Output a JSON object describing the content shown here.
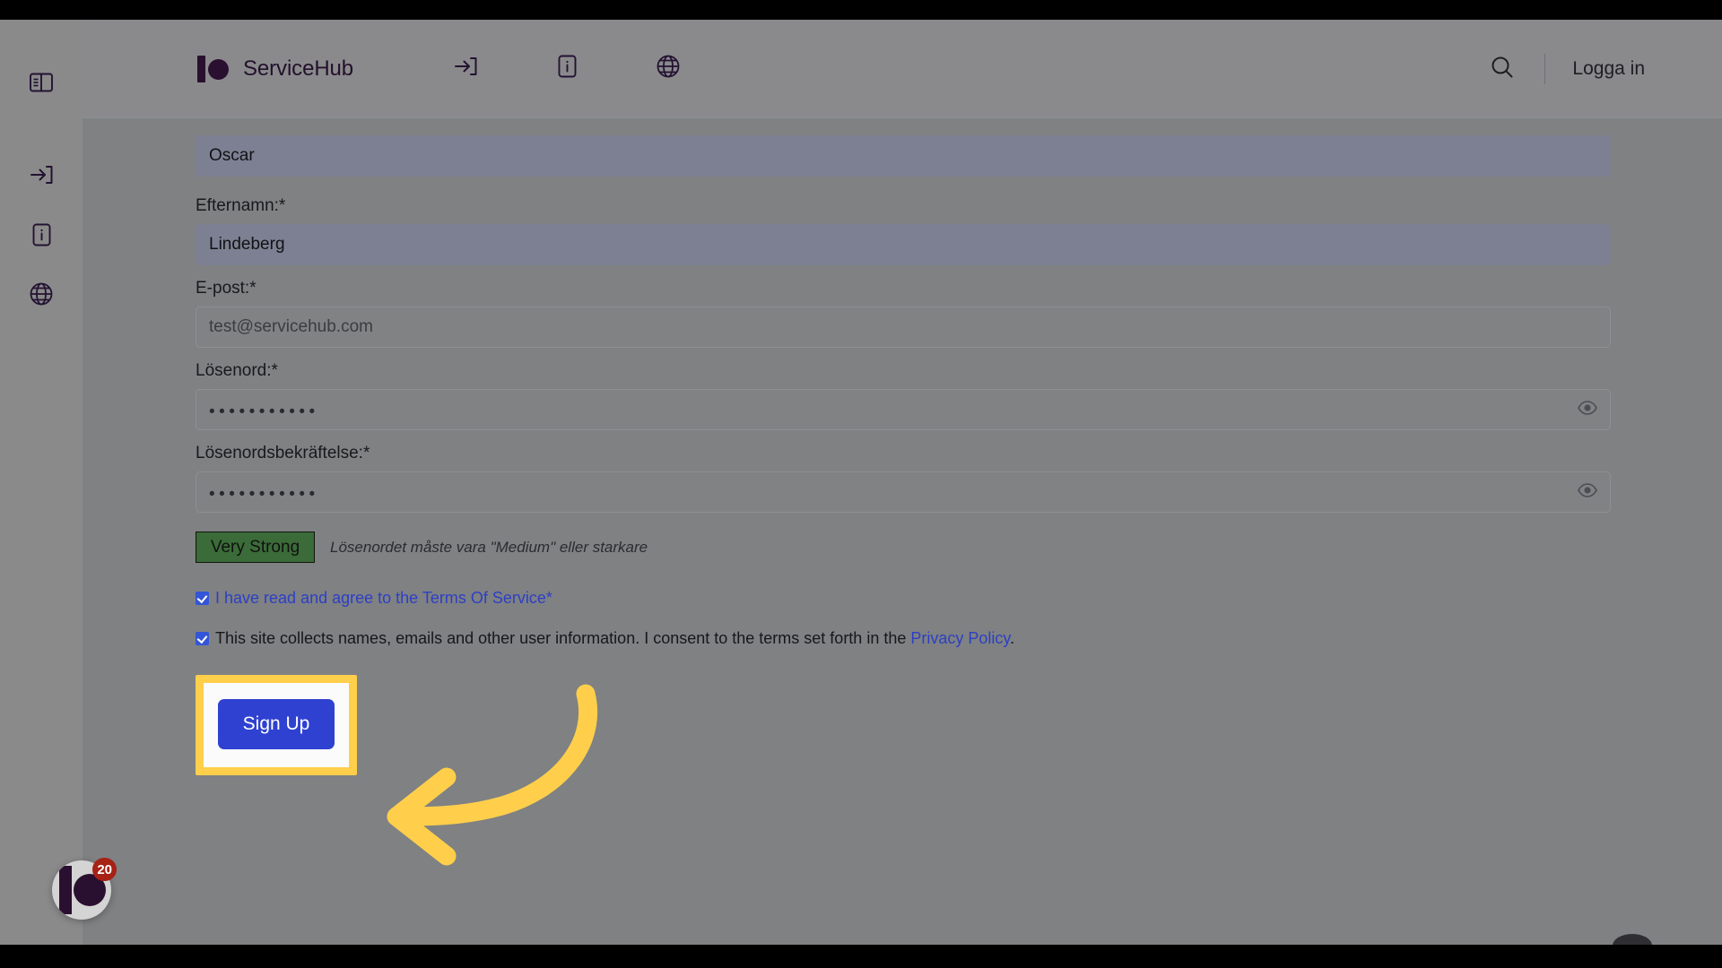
{
  "sidebar": {
    "items": [
      {
        "name": "panel-toggle",
        "icon": "panel-layout-icon"
      },
      {
        "name": "login",
        "icon": "login-arrow-icon"
      },
      {
        "name": "info",
        "icon": "info-document-icon"
      },
      {
        "name": "language",
        "icon": "globe-icon"
      }
    ]
  },
  "header": {
    "brand_name": "ServiceHub",
    "brand_logo_icon": "servicehub-logo-icon",
    "nav_icons": [
      {
        "name": "login",
        "icon": "login-arrow-icon"
      },
      {
        "name": "info",
        "icon": "info-document-icon"
      },
      {
        "name": "language",
        "icon": "globe-icon"
      }
    ],
    "search_icon": "search-icon",
    "login_label": "Logga in"
  },
  "form": {
    "first_name": {
      "value": "Oscar"
    },
    "last_name": {
      "label": "Efternamn:*",
      "value": "Lindeberg"
    },
    "email": {
      "label": "E-post:*",
      "value": "test@servicehub.com"
    },
    "password": {
      "label": "Lösenord:*",
      "masked_value": "•••••••••••",
      "toggle_icon": "eye-icon"
    },
    "password_confirm": {
      "label": "Lösenordsbekräftelse:*",
      "masked_value": "•••••••••••",
      "toggle_icon": "eye-icon"
    },
    "strength": {
      "badge_label": "Very Strong",
      "badge_color": "#3b6b38",
      "hint": "Lösenordet måste vara \"Medium\" eller starkare"
    },
    "terms_checkbox": {
      "checked": true,
      "text": "I have read and agree to the Terms Of Service",
      "required_marker": "*"
    },
    "privacy_checkbox": {
      "checked": true,
      "text_before": "This site collects names, emails and other user information. I consent to the terms set forth in the ",
      "link_label": "Privacy Policy",
      "text_after": "."
    },
    "submit": {
      "label": "Sign Up",
      "color": "#2f41d1",
      "highlight_color": "#ffcf4b"
    }
  },
  "chat_widget": {
    "unread_count": "20",
    "badge_color": "#a62215",
    "icon": "servicehub-logo-icon"
  },
  "annotation": {
    "arrow_icon": "curved-left-arrow-icon",
    "arrow_color": "#ffcf4b"
  }
}
